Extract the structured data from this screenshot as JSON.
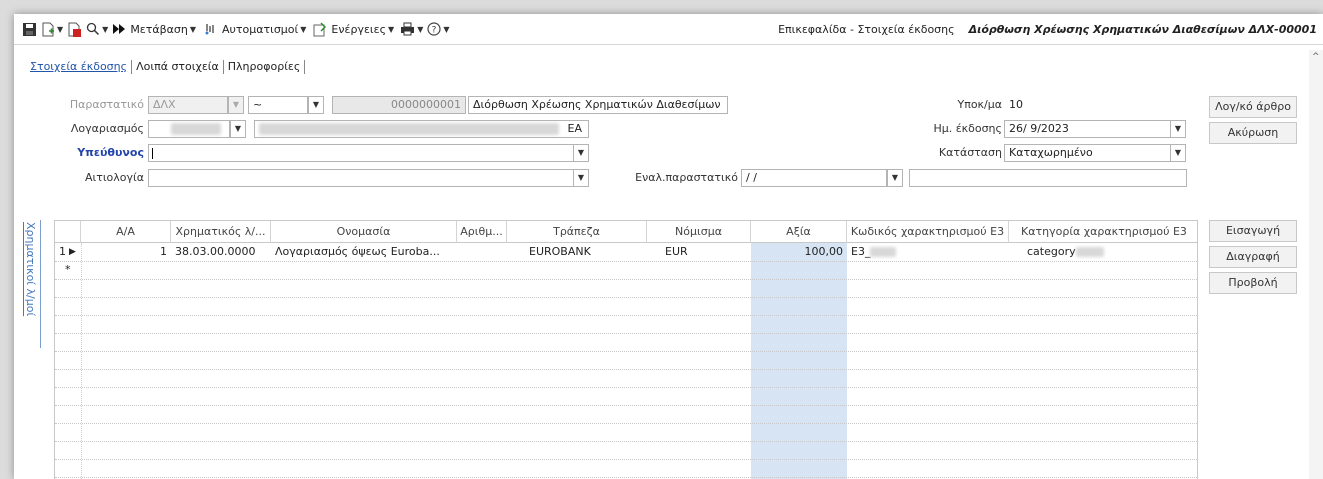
{
  "toolbar": {
    "goto_label": "Μετάβαση",
    "automations_label": "Αυτοματισμοί",
    "actions_label": "Ενέργειες",
    "header_section": "Επικεφαλίδα - Στοιχεία έκδοσης",
    "document_title": "Διόρθωση Χρέωσης Χρηματικών Διαθεσίμων ΔΛΧ-00001"
  },
  "tabs": [
    "Στοιχεία έκδοσης",
    "Λοιπά στοιχεία",
    "Πληροφορίες"
  ],
  "form": {
    "document_label": "Παραστατικό",
    "series_value": "ΔΛΧ",
    "tilde_value": "~",
    "number_value": "0000000001",
    "description_value": "Διόρθωση Χρέωσης Χρηματικών Διαθεσίμων",
    "branch_label": "Υποκ/μα",
    "branch_value": "10",
    "account_label": "Λογαριασμός",
    "account_name_tail": "ΕΑ",
    "issue_date_label": "Ημ. έκδοσης",
    "issue_date_value": "26/ 9/2023",
    "responsible_label": "Υπεύθυνος",
    "status_label": "Κατάσταση",
    "status_value": "Καταχωρημένο",
    "reason_label": "Αιτιολογία",
    "alt_doc_label": "Εναλ.παραστατικό",
    "alt_doc_date": "/  /"
  },
  "side_buttons": {
    "journal_entry": "Λογ/κό άρθρο",
    "cancel": "Ακύρωση",
    "insert": "Εισαγωγή",
    "delete": "Διαγραφή",
    "view": "Προβολή"
  },
  "side_tab_label": "Χρηματικοί λ/μοί",
  "grid": {
    "columns": [
      "Α/Α",
      "Χρηματικός λ/...",
      "Ονομασία",
      "Αριθμ...",
      "Τράπεζα",
      "Νόμισμα",
      "Αξία",
      "Κωδικός χαρακτηρισμού Ε3",
      "Κατηγορία χαρακτηρισμού Ε3"
    ],
    "rows": [
      {
        "row_num": "1",
        "aa": "1",
        "account": "38.03.00.0000",
        "name": "Λογαριασμός όψεως Euroba...",
        "number": "",
        "bank": "EUROBANK",
        "currency": "EUR",
        "value": "100,00",
        "e3_code": "E3_",
        "e3_category": "category"
      }
    ],
    "new_row_marker": "*"
  },
  "colors": {
    "accent_blue": "#2255aa",
    "value_column_bg": "#d6e4f4"
  }
}
